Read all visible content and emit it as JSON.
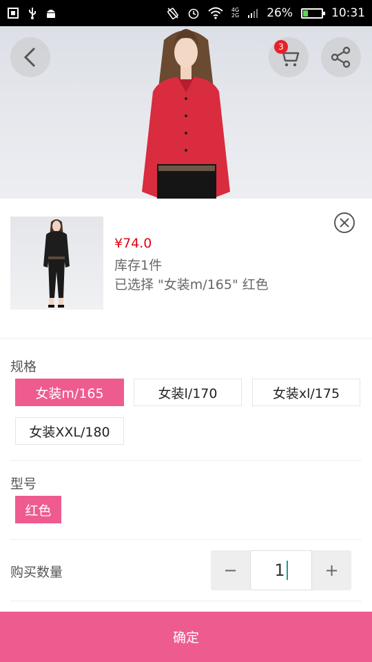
{
  "status_bar": {
    "battery_percent": "26%",
    "battery_level": 0.26,
    "time": "10:31",
    "network_top": "4G",
    "network_bottom": "2G",
    "icons": [
      "screenshot-icon",
      "usb-icon",
      "android-icon",
      "rotate-icon",
      "alarm-icon",
      "wifi-icon",
      "signal-icon",
      "battery-icon"
    ]
  },
  "header": {
    "cart_count": "3",
    "icons": [
      "back-icon",
      "cart-icon",
      "share-icon"
    ]
  },
  "product": {
    "price": "¥74.0",
    "stock": "库存1件",
    "selected": "已选择 \"女装m/165\" 红色"
  },
  "spec": {
    "title": "规格",
    "options": [
      "女装m/165",
      "女装l/170",
      "女装xl/175",
      "女装XXL/180"
    ],
    "selected_index": 0
  },
  "model": {
    "title": "型号",
    "options": [
      "红色"
    ],
    "selected_index": 0
  },
  "quantity": {
    "label": "购买数量",
    "minus": "−",
    "value": "1",
    "plus": "+"
  },
  "confirm_label": "确定",
  "colors": {
    "accent": "#ee5c8f",
    "price": "#e60012",
    "badge": "#e8202a",
    "status_bar": "#000000"
  }
}
